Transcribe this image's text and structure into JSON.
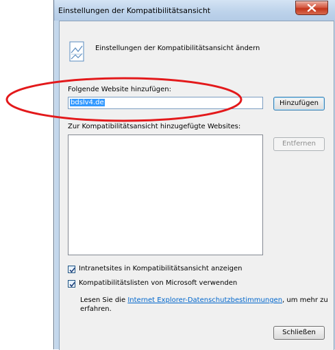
{
  "window": {
    "title": "Einstellungen der Kompatibilitätsansicht"
  },
  "header": {
    "icon": "compat-view-icon",
    "text": "Einstellungen der Kompatibilitätsansicht ändern"
  },
  "add_section": {
    "label": "Folgende Website hinzufügen:",
    "input_value": "bdslv4.de",
    "add_button": "Hinzufügen"
  },
  "list_section": {
    "label": "Zur Kompatibilitätsansicht hinzugefügte Websites:",
    "items": [],
    "remove_button": "Entfernen"
  },
  "options": [
    {
      "label": "Intranetsites in Kompatibilitätsansicht anzeigen",
      "checked": true
    },
    {
      "label": "Kompatibilitätslisten von Microsoft verwenden",
      "checked": true
    }
  ],
  "privacy": {
    "prefix": "Lesen Sie die ",
    "link": "Internet Explorer-Datenschutzbestimmungen",
    "suffix": ", um mehr zu erfahren."
  },
  "close_button": "Schließen",
  "colors": {
    "annotation": "#e3191b",
    "link": "#0066cc",
    "selection": "#3399ff"
  }
}
